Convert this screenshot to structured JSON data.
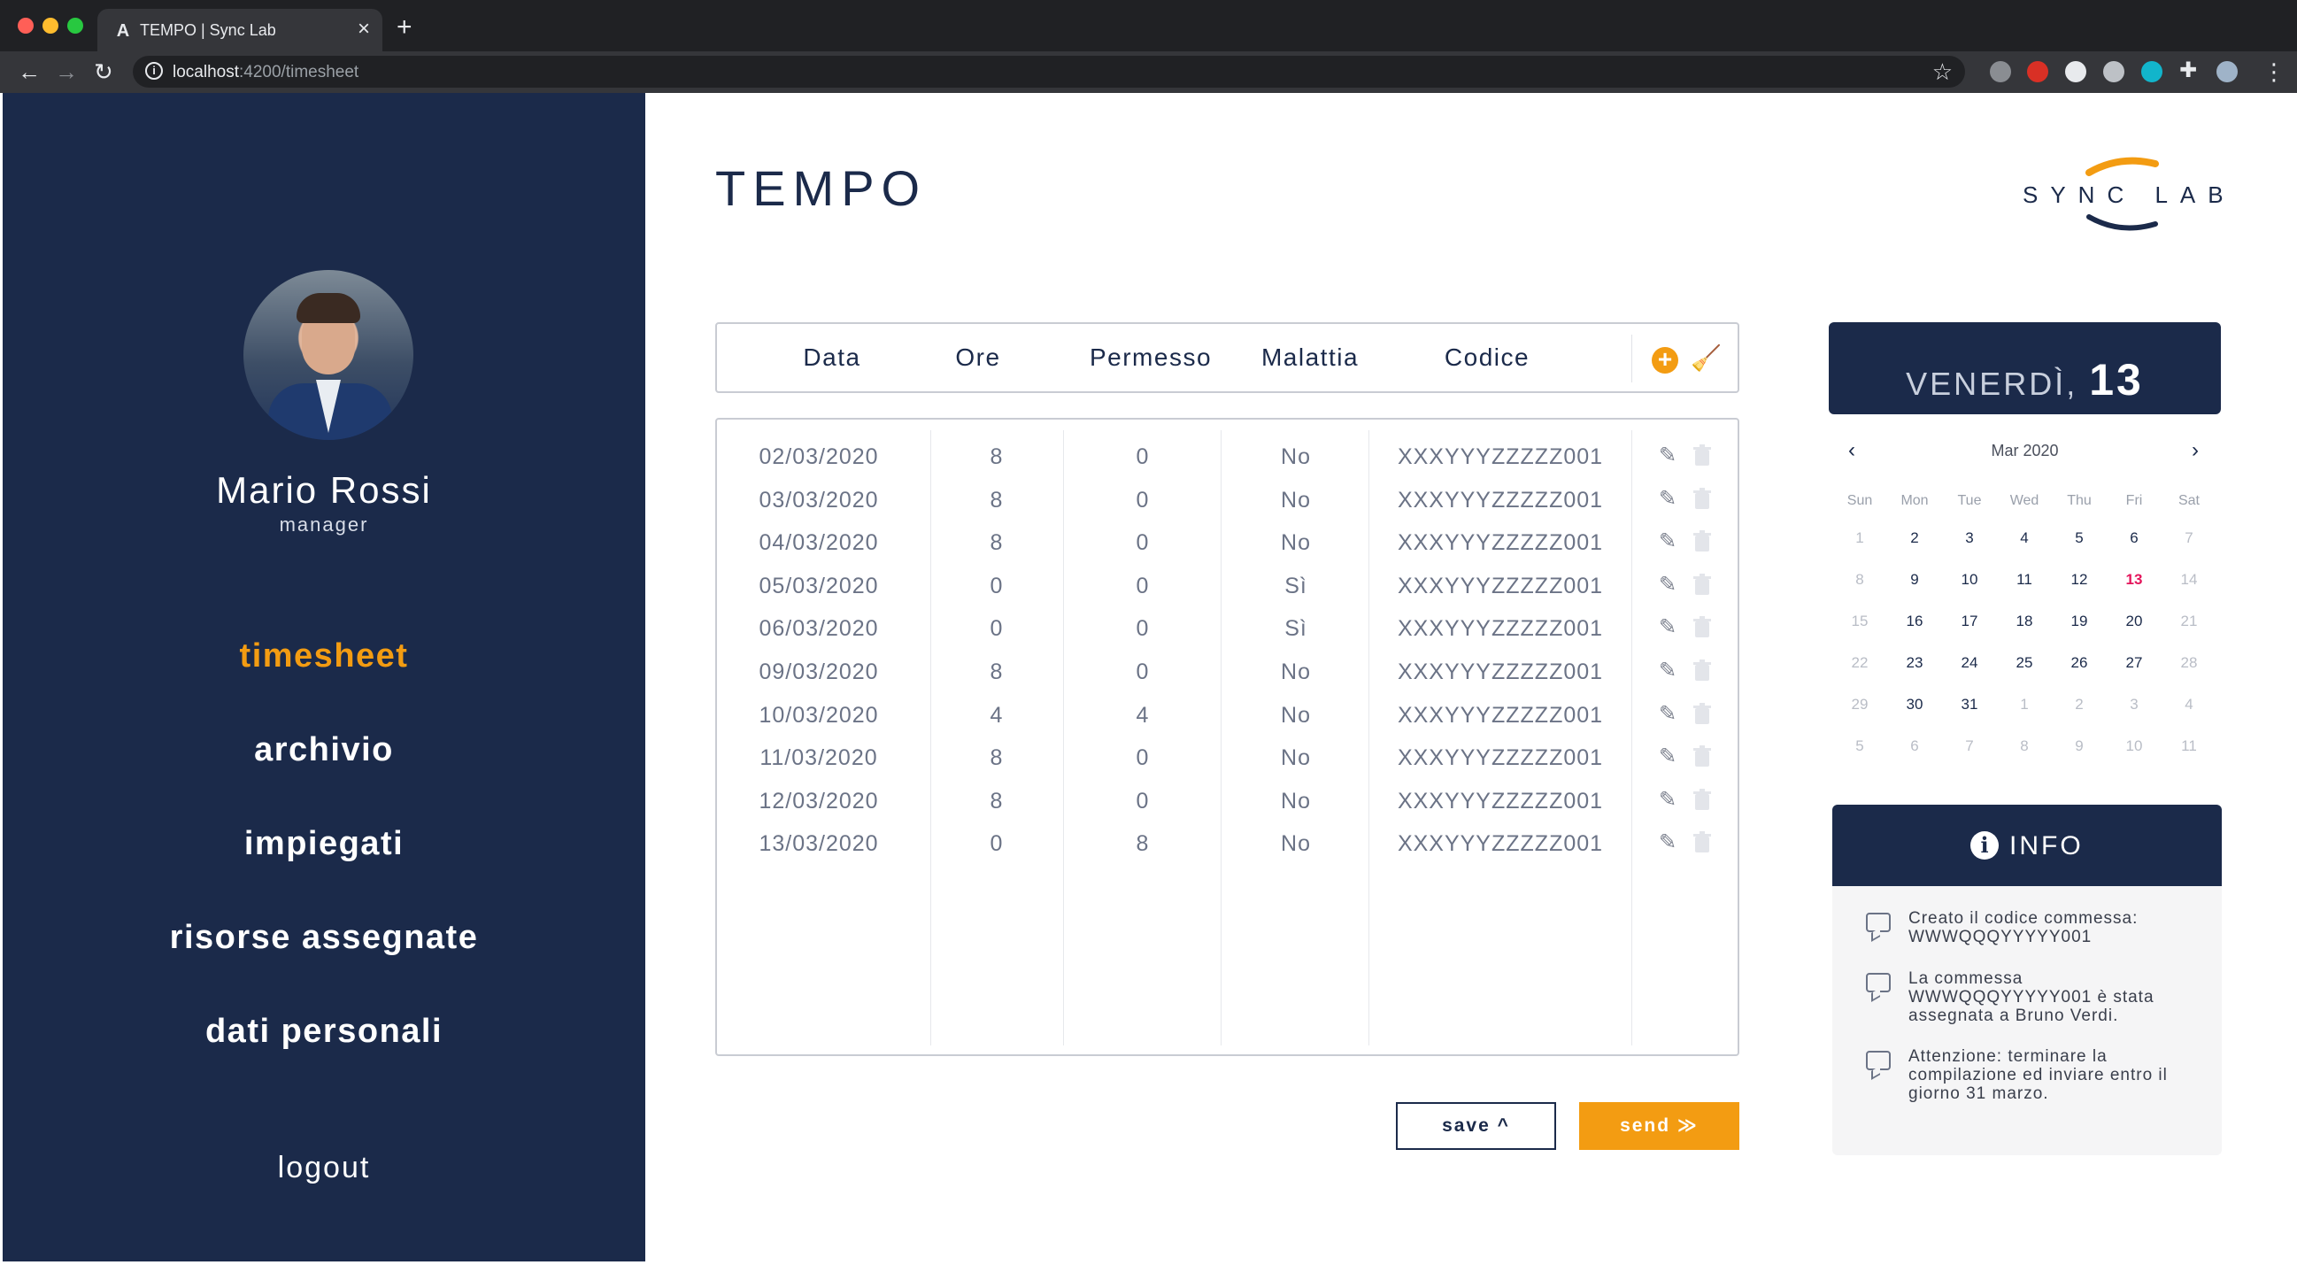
{
  "browser": {
    "tab_title": "TEMPO | Sync Lab",
    "tab_favicon": "A",
    "url_host": "localhost",
    "url_path": ":4200/timesheet"
  },
  "sidebar": {
    "user_name": "Mario Rossi",
    "user_role": "manager",
    "nav": [
      {
        "label": "timesheet",
        "active": true
      },
      {
        "label": "archivio",
        "active": false
      },
      {
        "label": "impiegati",
        "active": false
      },
      {
        "label": "risorse assegnate",
        "active": false
      },
      {
        "label": "dati personali",
        "active": false
      }
    ],
    "logout": "logout"
  },
  "header": {
    "title": "TEMPO",
    "logo_text": "SYNC LAB"
  },
  "table": {
    "columns": [
      "Data",
      "Ore",
      "Permesso",
      "Malattia",
      "Codice"
    ],
    "add_label": "+",
    "rows": [
      {
        "data": "02/03/2020",
        "ore": "8",
        "permesso": "0",
        "malattia": "No",
        "codice": "XXXYYYZZZZZ001"
      },
      {
        "data": "03/03/2020",
        "ore": "8",
        "permesso": "0",
        "malattia": "No",
        "codice": "XXXYYYZZZZZ001"
      },
      {
        "data": "04/03/2020",
        "ore": "8",
        "permesso": "0",
        "malattia": "No",
        "codice": "XXXYYYZZZZZ001"
      },
      {
        "data": "05/03/2020",
        "ore": "0",
        "permesso": "0",
        "malattia": "Sì",
        "codice": "XXXYYYZZZZZ001"
      },
      {
        "data": "06/03/2020",
        "ore": "0",
        "permesso": "0",
        "malattia": "Sì",
        "codice": "XXXYYYZZZZZ001"
      },
      {
        "data": "09/03/2020",
        "ore": "8",
        "permesso": "0",
        "malattia": "No",
        "codice": "XXXYYYZZZZZ001"
      },
      {
        "data": "10/03/2020",
        "ore": "4",
        "permesso": "4",
        "malattia": "No",
        "codice": "XXXYYYZZZZZ001"
      },
      {
        "data": "11/03/2020",
        "ore": "8",
        "permesso": "0",
        "malattia": "No",
        "codice": "XXXYYYZZZZZ001"
      },
      {
        "data": "12/03/2020",
        "ore": "8",
        "permesso": "0",
        "malattia": "No",
        "codice": "XXXYYYZZZZZ001"
      },
      {
        "data": "13/03/2020",
        "ore": "0",
        "permesso": "8",
        "malattia": "No",
        "codice": "XXXYYYZZZZZ001"
      }
    ]
  },
  "actions": {
    "save": "save ^",
    "send": "send ≫"
  },
  "date_card": {
    "weekday": "VENERDÌ,",
    "day": "13"
  },
  "calendar": {
    "month": "Mar 2020",
    "weekdays": [
      "Sun",
      "Mon",
      "Tue",
      "Wed",
      "Thu",
      "Fri",
      "Sat"
    ],
    "weeks": [
      [
        "1",
        "2",
        "3",
        "4",
        "5",
        "6",
        "7"
      ],
      [
        "8",
        "9",
        "10",
        "11",
        "12",
        "13",
        "14"
      ],
      [
        "15",
        "16",
        "17",
        "18",
        "19",
        "20",
        "21"
      ],
      [
        "22",
        "23",
        "24",
        "25",
        "26",
        "27",
        "28"
      ],
      [
        "29",
        "30",
        "31",
        "1",
        "2",
        "3",
        "4"
      ],
      [
        "5",
        "6",
        "7",
        "8",
        "9",
        "10",
        "11"
      ]
    ],
    "today": "13"
  },
  "info": {
    "title": "INFO",
    "items": [
      "Creato il codice commessa: WWWQQQYYYYY001",
      "La commessa WWWQQQYYYYY001 è stata assegnata a Bruno Verdi.",
      "Attenzione: terminare la compilazione ed inviare entro il giorno 31 marzo."
    ]
  },
  "colors": {
    "navy": "#1b2a4a",
    "accent": "#f39c12",
    "today": "#e4155b"
  }
}
